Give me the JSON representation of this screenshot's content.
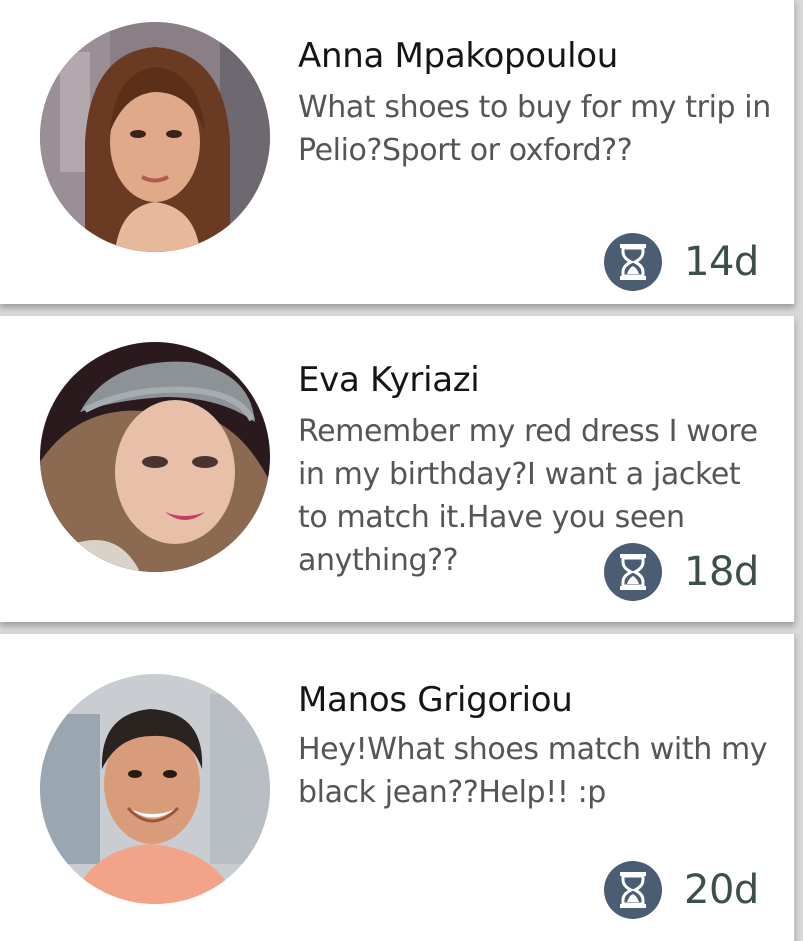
{
  "colors": {
    "background": "#d9d9d9",
    "card": "#ffffff",
    "timer_badge": "#4a5d73",
    "age_text": "#3c4f4a",
    "name_text": "#151515",
    "message_text": "#555555"
  },
  "requests": [
    {
      "name": "Anna Mpakopoulou",
      "message": "What shoes to buy for my trip in Pelio?Sport or oxford??",
      "age": "14d",
      "icon": "hourglass-icon"
    },
    {
      "name": "Eva Kyriazi",
      "message": "Remember my red dress I wore in my birthday?I want a jacket to match it.Have you seen anything??",
      "age": "18d",
      "icon": "hourglass-icon"
    },
    {
      "name": "Manos Grigoriou",
      "message": "Hey!What shoes match with my black jean??Help!! :p",
      "age": "20d",
      "icon": "hourglass-icon"
    }
  ]
}
